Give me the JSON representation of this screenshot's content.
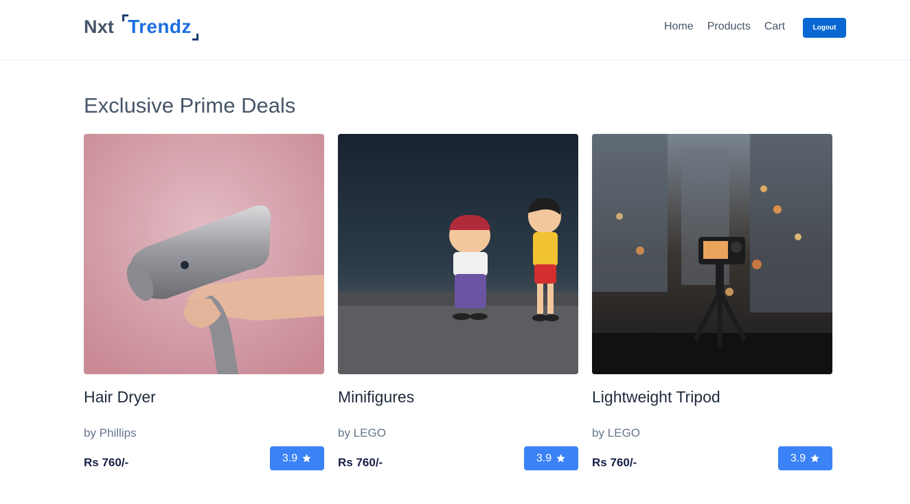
{
  "brand": {
    "part1": "Nxt",
    "part2": "Trendz"
  },
  "nav": {
    "links": [
      "Home",
      "Products",
      "Cart"
    ],
    "logout_label": "Logout"
  },
  "section": {
    "title": "Exclusive Prime Deals"
  },
  "products": [
    {
      "name": "Hair Dryer",
      "brand": "by Phillips",
      "price": "Rs 760/-",
      "rating": "3.9"
    },
    {
      "name": "Minifigures",
      "brand": "by LEGO",
      "price": "Rs 760/-",
      "rating": "3.9"
    },
    {
      "name": "Lightweight Tripod",
      "brand": "by LEGO",
      "price": "Rs 760/-",
      "rating": "3.9"
    }
  ],
  "colors": {
    "accent": "#0967d2",
    "rating_bg": "#3b82f6",
    "logo_blue": "#1e6fe0"
  },
  "icons": {
    "rating": "star-icon"
  }
}
